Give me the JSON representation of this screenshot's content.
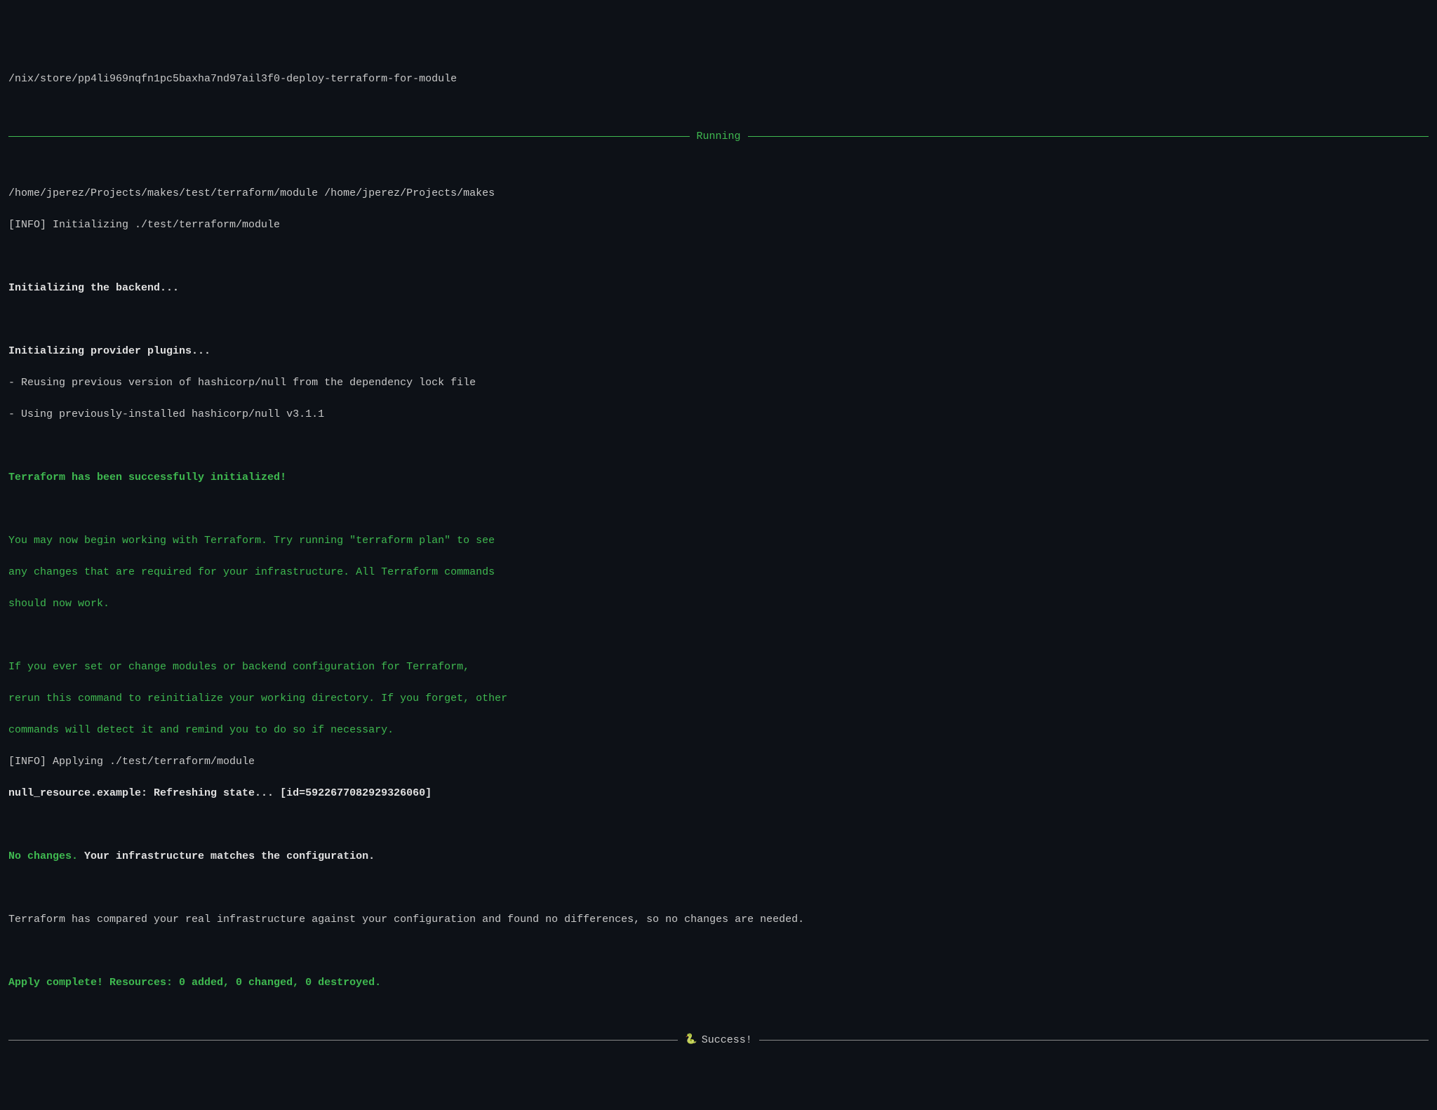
{
  "header": {
    "path": "/nix/store/pp4li969nqfn1pc5baxha7nd97ail3f0-deploy-terraform-for-module"
  },
  "divider1": {
    "label": "Running"
  },
  "lines": {
    "l1": "/home/jperez/Projects/makes/test/terraform/module /home/jperez/Projects/makes",
    "l2": "[INFO] Initializing ./test/terraform/module",
    "l3": "Initializing the backend...",
    "l4": "Initializing provider plugins...",
    "l5": "- Reusing previous version of hashicorp/null from the dependency lock file",
    "l6": "- Using previously-installed hashicorp/null v3.1.1",
    "l7": "Terraform has been successfully initialized!",
    "l8": "You may now begin working with Terraform. Try running \"terraform plan\" to see",
    "l9": "any changes that are required for your infrastructure. All Terraform commands",
    "l10": "should now work.",
    "l11": "If you ever set or change modules or backend configuration for Terraform,",
    "l12": "rerun this command to reinitialize your working directory. If you forget, other",
    "l13": "commands will detect it and remind you to do so if necessary.",
    "l14": "[INFO] Applying ./test/terraform/module",
    "l15": "null_resource.example: Refreshing state... [id=5922677082929326060]",
    "l16a": "No changes.",
    "l16b": " Your infrastructure matches the configuration.",
    "l17": "Terraform has compared your real infrastructure against your configuration and found no differences, so no changes are needed.",
    "l18": "Apply complete! Resources: 0 added, 0 changed, 0 destroyed."
  },
  "divider2": {
    "icon": "🐍",
    "label": "Success!"
  }
}
